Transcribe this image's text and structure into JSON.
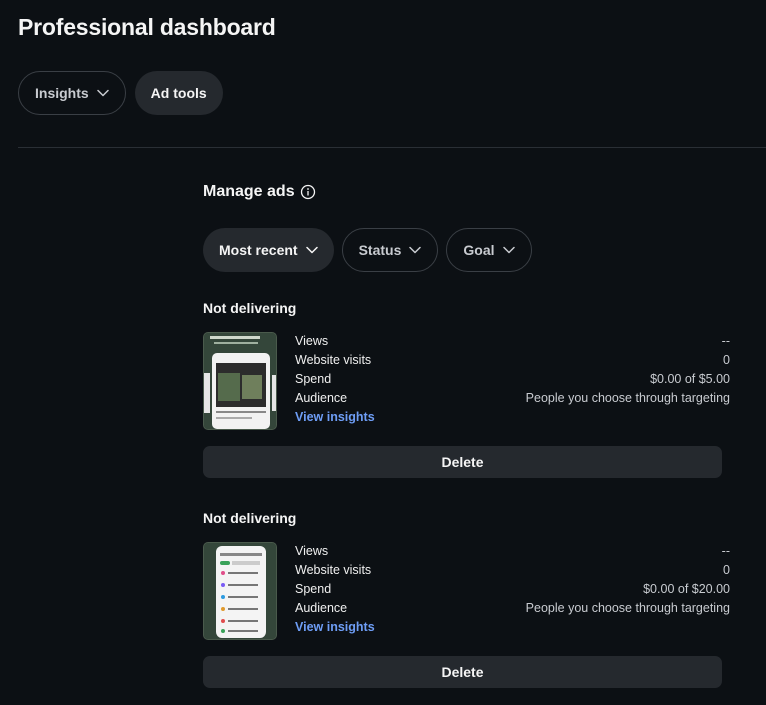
{
  "page": {
    "title": "Professional dashboard"
  },
  "tabs": [
    {
      "label": "Insights",
      "has_dropdown": true
    },
    {
      "label": "Ad tools",
      "has_dropdown": false
    }
  ],
  "manage_ads": {
    "title": "Manage ads",
    "filters": [
      {
        "label": "Most recent"
      },
      {
        "label": "Status"
      },
      {
        "label": "Goal"
      }
    ]
  },
  "ads": [
    {
      "status": "Not delivering",
      "stats": [
        {
          "label": "Views",
          "value": "--"
        },
        {
          "label": "Website visits",
          "value": "0"
        },
        {
          "label": "Spend",
          "value": "$0.00 of $5.00"
        },
        {
          "label": "Audience",
          "value": "People you choose through targeting"
        }
      ],
      "view_insights": "View insights",
      "delete_label": "Delete"
    },
    {
      "status": "Not delivering",
      "stats": [
        {
          "label": "Views",
          "value": "--"
        },
        {
          "label": "Website visits",
          "value": "0"
        },
        {
          "label": "Spend",
          "value": "$0.00 of $20.00"
        },
        {
          "label": "Audience",
          "value": "People you choose through targeting"
        }
      ],
      "view_insights": "View insights",
      "delete_label": "Delete"
    }
  ],
  "colors": {
    "background": "#0c1014",
    "link": "#6e9df5",
    "button": "#25292e"
  }
}
